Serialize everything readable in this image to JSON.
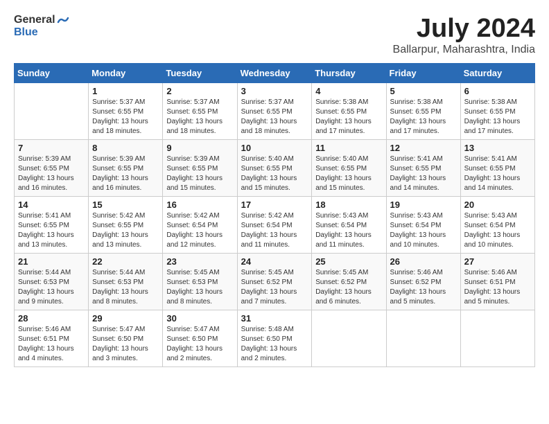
{
  "logo": {
    "general": "General",
    "blue": "Blue"
  },
  "title": {
    "month": "July 2024",
    "location": "Ballarpur, Maharashtra, India"
  },
  "weekdays": [
    "Sunday",
    "Monday",
    "Tuesday",
    "Wednesday",
    "Thursday",
    "Friday",
    "Saturday"
  ],
  "weeks": [
    [
      {
        "day": "",
        "info": ""
      },
      {
        "day": "1",
        "info": "Sunrise: 5:37 AM\nSunset: 6:55 PM\nDaylight: 13 hours\nand 18 minutes."
      },
      {
        "day": "2",
        "info": "Sunrise: 5:37 AM\nSunset: 6:55 PM\nDaylight: 13 hours\nand 18 minutes."
      },
      {
        "day": "3",
        "info": "Sunrise: 5:37 AM\nSunset: 6:55 PM\nDaylight: 13 hours\nand 18 minutes."
      },
      {
        "day": "4",
        "info": "Sunrise: 5:38 AM\nSunset: 6:55 PM\nDaylight: 13 hours\nand 17 minutes."
      },
      {
        "day": "5",
        "info": "Sunrise: 5:38 AM\nSunset: 6:55 PM\nDaylight: 13 hours\nand 17 minutes."
      },
      {
        "day": "6",
        "info": "Sunrise: 5:38 AM\nSunset: 6:55 PM\nDaylight: 13 hours\nand 17 minutes."
      }
    ],
    [
      {
        "day": "7",
        "info": "Sunrise: 5:39 AM\nSunset: 6:55 PM\nDaylight: 13 hours\nand 16 minutes."
      },
      {
        "day": "8",
        "info": "Sunrise: 5:39 AM\nSunset: 6:55 PM\nDaylight: 13 hours\nand 16 minutes."
      },
      {
        "day": "9",
        "info": "Sunrise: 5:39 AM\nSunset: 6:55 PM\nDaylight: 13 hours\nand 15 minutes."
      },
      {
        "day": "10",
        "info": "Sunrise: 5:40 AM\nSunset: 6:55 PM\nDaylight: 13 hours\nand 15 minutes."
      },
      {
        "day": "11",
        "info": "Sunrise: 5:40 AM\nSunset: 6:55 PM\nDaylight: 13 hours\nand 15 minutes."
      },
      {
        "day": "12",
        "info": "Sunrise: 5:41 AM\nSunset: 6:55 PM\nDaylight: 13 hours\nand 14 minutes."
      },
      {
        "day": "13",
        "info": "Sunrise: 5:41 AM\nSunset: 6:55 PM\nDaylight: 13 hours\nand 14 minutes."
      }
    ],
    [
      {
        "day": "14",
        "info": "Sunrise: 5:41 AM\nSunset: 6:55 PM\nDaylight: 13 hours\nand 13 minutes."
      },
      {
        "day": "15",
        "info": "Sunrise: 5:42 AM\nSunset: 6:55 PM\nDaylight: 13 hours\nand 13 minutes."
      },
      {
        "day": "16",
        "info": "Sunrise: 5:42 AM\nSunset: 6:54 PM\nDaylight: 13 hours\nand 12 minutes."
      },
      {
        "day": "17",
        "info": "Sunrise: 5:42 AM\nSunset: 6:54 PM\nDaylight: 13 hours\nand 11 minutes."
      },
      {
        "day": "18",
        "info": "Sunrise: 5:43 AM\nSunset: 6:54 PM\nDaylight: 13 hours\nand 11 minutes."
      },
      {
        "day": "19",
        "info": "Sunrise: 5:43 AM\nSunset: 6:54 PM\nDaylight: 13 hours\nand 10 minutes."
      },
      {
        "day": "20",
        "info": "Sunrise: 5:43 AM\nSunset: 6:54 PM\nDaylight: 13 hours\nand 10 minutes."
      }
    ],
    [
      {
        "day": "21",
        "info": "Sunrise: 5:44 AM\nSunset: 6:53 PM\nDaylight: 13 hours\nand 9 minutes."
      },
      {
        "day": "22",
        "info": "Sunrise: 5:44 AM\nSunset: 6:53 PM\nDaylight: 13 hours\nand 8 minutes."
      },
      {
        "day": "23",
        "info": "Sunrise: 5:45 AM\nSunset: 6:53 PM\nDaylight: 13 hours\nand 8 minutes."
      },
      {
        "day": "24",
        "info": "Sunrise: 5:45 AM\nSunset: 6:52 PM\nDaylight: 13 hours\nand 7 minutes."
      },
      {
        "day": "25",
        "info": "Sunrise: 5:45 AM\nSunset: 6:52 PM\nDaylight: 13 hours\nand 6 minutes."
      },
      {
        "day": "26",
        "info": "Sunrise: 5:46 AM\nSunset: 6:52 PM\nDaylight: 13 hours\nand 5 minutes."
      },
      {
        "day": "27",
        "info": "Sunrise: 5:46 AM\nSunset: 6:51 PM\nDaylight: 13 hours\nand 5 minutes."
      }
    ],
    [
      {
        "day": "28",
        "info": "Sunrise: 5:46 AM\nSunset: 6:51 PM\nDaylight: 13 hours\nand 4 minutes."
      },
      {
        "day": "29",
        "info": "Sunrise: 5:47 AM\nSunset: 6:50 PM\nDaylight: 13 hours\nand 3 minutes."
      },
      {
        "day": "30",
        "info": "Sunrise: 5:47 AM\nSunset: 6:50 PM\nDaylight: 13 hours\nand 2 minutes."
      },
      {
        "day": "31",
        "info": "Sunrise: 5:48 AM\nSunset: 6:50 PM\nDaylight: 13 hours\nand 2 minutes."
      },
      {
        "day": "",
        "info": ""
      },
      {
        "day": "",
        "info": ""
      },
      {
        "day": "",
        "info": ""
      }
    ]
  ]
}
